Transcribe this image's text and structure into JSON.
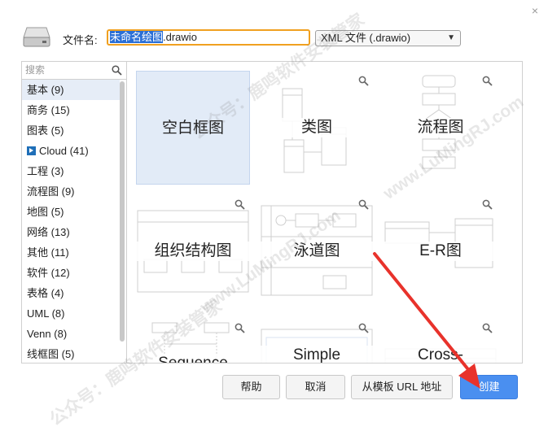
{
  "dialog": {
    "close_glyph": "×",
    "filename_label": "文件名:",
    "filename_selected": "未命名绘图",
    "filename_ext": ".drawio",
    "format_value": "XML 文件 (.drawio)"
  },
  "sidebar": {
    "search_placeholder": "搜索",
    "categories": [
      {
        "label": "基本 (9)"
      },
      {
        "label": "商务 (15)"
      },
      {
        "label": "图表 (5)"
      },
      {
        "label": "Cloud (41)"
      },
      {
        "label": "工程 (3)"
      },
      {
        "label": "流程图 (9)"
      },
      {
        "label": "地图 (5)"
      },
      {
        "label": "网络 (13)"
      },
      {
        "label": "其他 (11)"
      },
      {
        "label": "软件 (12)"
      },
      {
        "label": "表格 (4)"
      },
      {
        "label": "UML (8)"
      },
      {
        "label": "Venn (8)"
      },
      {
        "label": "线框图 (5)"
      }
    ]
  },
  "templates": [
    {
      "label": "空白框图"
    },
    {
      "label": "类图"
    },
    {
      "label": "流程图"
    },
    {
      "label": "组织结构图"
    },
    {
      "label": "泳道图"
    },
    {
      "label": "E-R图"
    },
    {
      "label": "Sequence"
    },
    {
      "label": "Simple"
    },
    {
      "label": "Cross-"
    }
  ],
  "buttons": {
    "help": "帮助",
    "cancel": "取消",
    "from_url": "从模板 URL 地址",
    "create": "创建"
  },
  "watermark": {
    "text_a": "公众号：鹿鸣软件安装管家",
    "text_b": "www.LuMingRJ.com"
  },
  "colors": {
    "accent": "#4a8ff0",
    "selection": "#e2ebf7",
    "focus_border": "#f0a020",
    "arrow": "#e8322b"
  }
}
